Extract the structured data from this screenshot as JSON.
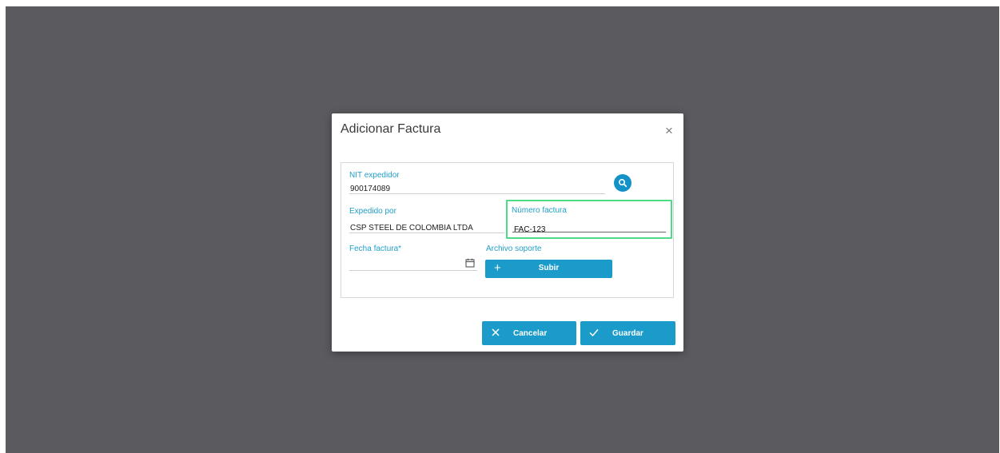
{
  "modal": {
    "title": "Adicionar Factura",
    "close_icon": "close-icon"
  },
  "form": {
    "nit": {
      "label": "NIT expedidor",
      "value": "900174089"
    },
    "search_icon": "search-icon",
    "expedido_por": {
      "label": "Expedido por",
      "value": "CSP STEEL DE COLOMBIA LTDA"
    },
    "numero_factura": {
      "label": "Número factura",
      "value": "FAC-123"
    },
    "fecha_factura": {
      "label": "Fecha factura*",
      "value": ""
    },
    "calendar_icon": "calendar-icon",
    "archivo_soporte": {
      "label": "Archivo soporte",
      "button_label": "Subir",
      "button_icon": "plus-icon"
    }
  },
  "actions": {
    "cancel": {
      "label": "Cancelar",
      "icon": "x-icon"
    },
    "save": {
      "label": "Guardar",
      "icon": "check-icon"
    }
  },
  "colors": {
    "overlay": "#5b5a5f",
    "accent": "#1a9bc9",
    "label": "#22a0c8",
    "focus_highlight": "#4ddb88"
  }
}
